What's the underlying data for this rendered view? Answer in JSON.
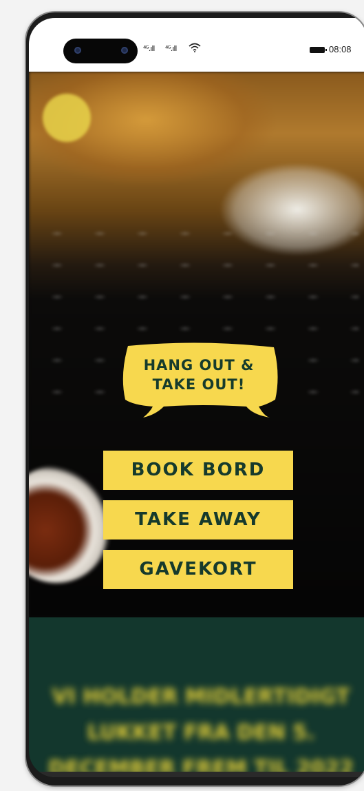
{
  "status_bar": {
    "signal_left": "⁴ᴳ.ıll",
    "signal_right": "⁴ᴳ.ıll",
    "time": "08:08",
    "wifi_icon": "wifi-icon",
    "battery_icon": "battery-icon"
  },
  "hero": {
    "speech_bubble": "HANG OUT &\nTAKE OUT!",
    "bubble_color": "#f7d84e"
  },
  "buttons": {
    "book": "BOOK BORD",
    "takeaway": "TAKE AWAY",
    "giftcard": "GAVEKORT"
  },
  "promo": {
    "text": "VI HOLDER MIDLERTIDIGT\nLUKKET FRA DEN 5.\nDECEMBER FREM TIL 2022"
  },
  "colors": {
    "accent": "#f7d84e",
    "dark_green": "#13372d",
    "text_green": "#163a2c"
  }
}
